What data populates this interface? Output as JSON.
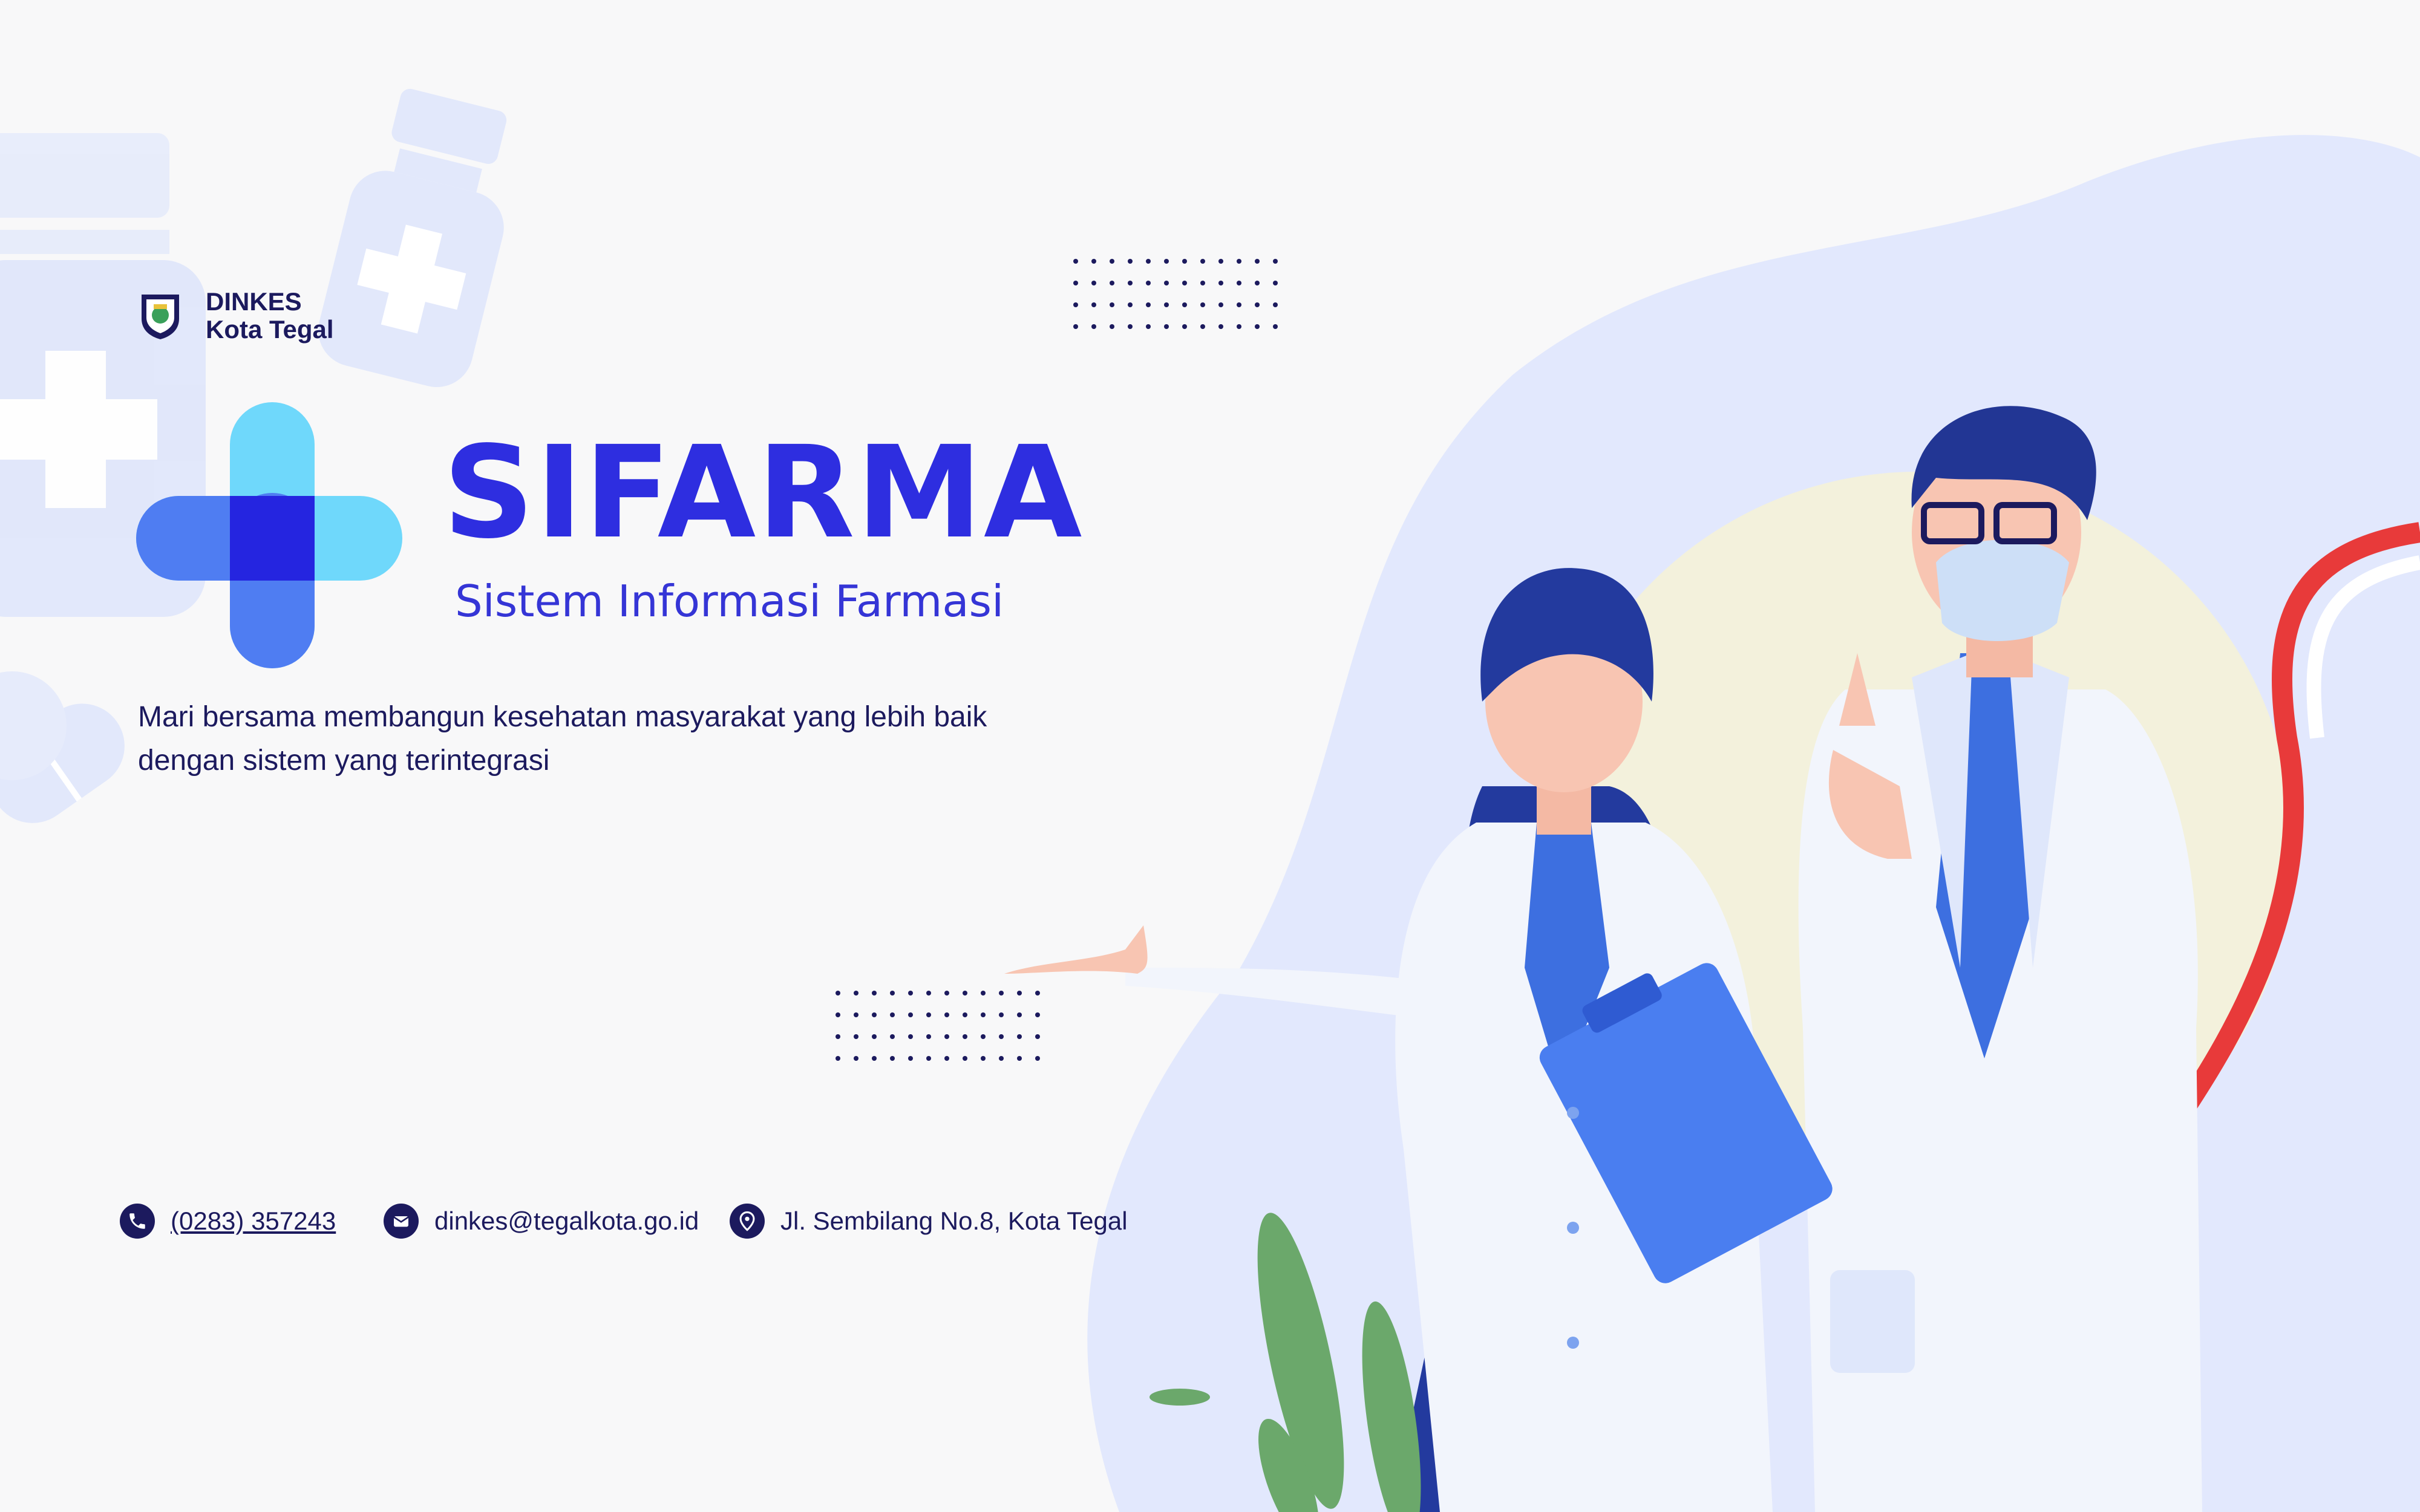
{
  "org": {
    "line1": "DINKES",
    "line2": "Kota Tegal"
  },
  "brand": {
    "title": "SIFARMA",
    "subtitle": "Sistem Informasi Farmasi"
  },
  "tagline": {
    "line1": "Mari bersama membangun kesehatan masyarakat yang lebih baik",
    "line2": "dengan sistem yang terintegrasi"
  },
  "contacts": {
    "phone": "(0283) 357243",
    "email": "dinkes@tegalkota.go.id",
    "address": "Jl. Sembilang No.8, Kota Tegal"
  },
  "colors": {
    "primary": "#2e2ee0",
    "navy": "#1c1a5e",
    "background": "#f8f8f9",
    "blob": "#e2e8fd",
    "accent_cyan": "#6fd8fb"
  },
  "icons": [
    "logo-emblem-icon",
    "medical-cross-logo-icon",
    "phone-icon",
    "mail-icon",
    "location-pin-icon"
  ]
}
